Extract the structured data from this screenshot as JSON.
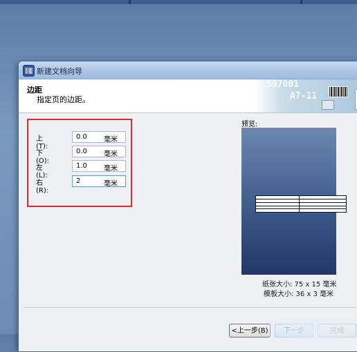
{
  "window": {
    "title": "新建文档向导",
    "app_icon": "label-app-icon"
  },
  "header": {
    "title": "边距",
    "subtitle": "指定页的边距。",
    "graphic_text_1": "597001",
    "graphic_text_2": "A7-11"
  },
  "margins": {
    "fields": [
      {
        "label": "上(T):",
        "value": "0.0",
        "unit": "毫米"
      },
      {
        "label": "下(O):",
        "value": "0.0",
        "unit": "毫米"
      },
      {
        "label": "左(L):",
        "value": "1.0",
        "unit": "毫米"
      },
      {
        "label": "右(R):",
        "value": "2",
        "unit": "毫米"
      }
    ],
    "highlight_color": "#e02a2a"
  },
  "preview": {
    "label": "预览:",
    "paper_size": "纸张大小: 75 x 15 毫米",
    "template_size": "模板大小: 36 x 3 毫米"
  },
  "buttons": {
    "back": "<上一步(B)",
    "next": "下一步",
    "finish": "完成"
  }
}
